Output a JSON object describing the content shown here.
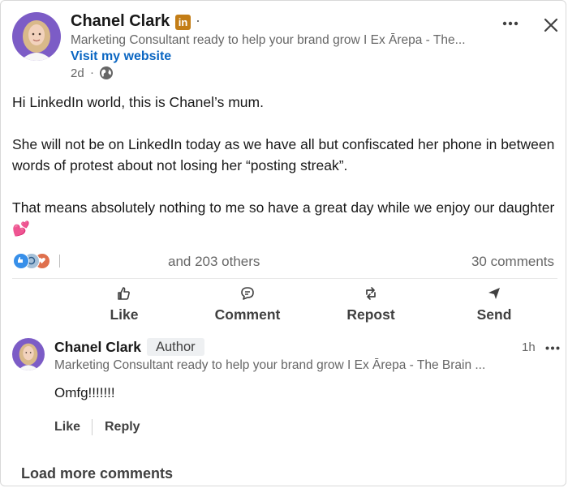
{
  "post": {
    "author_name": "Chanel Clark",
    "badge_text": "in",
    "dot": "·",
    "headline": "Marketing Consultant ready to help your brand grow I Ex Ārepa - The...",
    "website_link": "Visit my website",
    "time": "2d",
    "time_dot": "·",
    "paragraphs": [
      "Hi LinkedIn world, this is Chanel’s mum.",
      "She will not be on LinkedIn today as we have all but confiscated her phone in between words of protest about not losing her “posting streak”.",
      "That means absolutely nothing to me so have a great day while we enjoy our daughter 💕"
    ]
  },
  "social": {
    "others": "and 203 others",
    "comments": "30 comments",
    "reaction_colors": [
      "#378fe9",
      "#44712e",
      "#df704d"
    ]
  },
  "actions": {
    "like": "Like",
    "comment": "Comment",
    "repost": "Repost",
    "send": "Send"
  },
  "comment": {
    "author_name": "Chanel Clark",
    "author_badge": "Author",
    "headline": "Marketing Consultant ready to help your brand grow I Ex Ārepa - The Brain ...",
    "time": "1h",
    "text": "Omfg!!!!!!!",
    "like": "Like",
    "reply": "Reply"
  },
  "load_more": "Load more comments",
  "colors": {
    "accent": "#0a66c2",
    "avatar_bg": "#7c5cc6"
  }
}
